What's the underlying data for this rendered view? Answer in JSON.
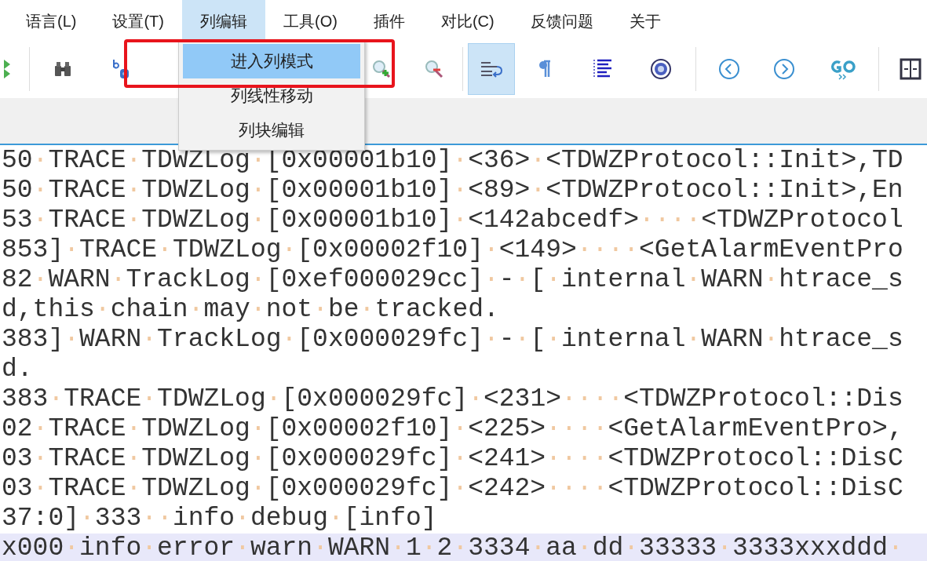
{
  "menu_bar": [
    {
      "label": "语言(L)",
      "selected": false
    },
    {
      "label": "设置(T)",
      "selected": false
    },
    {
      "label": "列编辑",
      "selected": true
    },
    {
      "label": "工具(O)",
      "selected": false
    },
    {
      "label": "插件",
      "selected": false
    },
    {
      "label": "对比(C)",
      "selected": false
    },
    {
      "label": "反馈问题",
      "selected": false
    },
    {
      "label": "关于",
      "selected": false
    }
  ],
  "dropdown": [
    {
      "label": "进入列模式",
      "selected": true
    },
    {
      "label": "列线性移动",
      "selected": false
    },
    {
      "label": "列块编辑",
      "selected": false
    }
  ],
  "toolbar": [
    {
      "selected": false
    },
    {
      "selected": false
    },
    {
      "selected": false
    },
    {
      "selected": false
    },
    {
      "selected": false
    },
    {
      "selected": true
    },
    {
      "selected": false
    },
    {
      "selected": false
    },
    {
      "selected": false
    },
    {
      "selected": false
    },
    {
      "selected": false
    },
    {
      "selected": false
    },
    {
      "selected": false
    }
  ],
  "editor_lines": [
    {
      "text": "50·TRACE·TDWZLog·[0x00001b10]·<36>·<TDWZProtocol::Init>,TD",
      "current": false
    },
    {
      "text": "50·TRACE·TDWZLog·[0x00001b10]·<89>·<TDWZProtocol::Init>,En",
      "current": false
    },
    {
      "text": "53·TRACE·TDWZLog·[0x00001b10]·<142abcedf>····<TDWZProtocol",
      "current": false
    },
    {
      "text": "853]·TRACE·TDWZLog·[0x00002f10]·<149>····<GetAlarmEventPro",
      "current": false
    },
    {
      "text": "82·WARN·TrackLog·[0xef000029cc]·-·[·internal·WARN·htrace_s",
      "current": false
    },
    {
      "text": "d,this·chain·may·not·be·tracked.",
      "current": false
    },
    {
      "text": "383]·WARN·TrackLog·[0x000029fc]·-·[·internal·WARN·htrace_s",
      "current": false
    },
    {
      "text": "d.",
      "current": false
    },
    {
      "text": "383·TRACE·TDWZLog·[0x000029fc]·<231>····<TDWZProtocol::Dis",
      "current": false
    },
    {
      "text": "02·TRACE·TDWZLog·[0x00002f10]·<225>····<GetAlarmEventPro>,",
      "current": false
    },
    {
      "text": "03·TRACE·TDWZLog·[0x000029fc]·<241>····<TDWZProtocol::DisC",
      "current": false
    },
    {
      "text": "03·TRACE·TDWZLog·[0x000029fc]·<242>····<TDWZProtocol::DisC",
      "current": false
    },
    {
      "text": "37:0]·333··info·debug·[info]",
      "current": false
    },
    {
      "text": "x000·info·error·warn·WARN·1·2·3334·aa·dd·33333·3333xxxddd·",
      "current": true
    }
  ]
}
